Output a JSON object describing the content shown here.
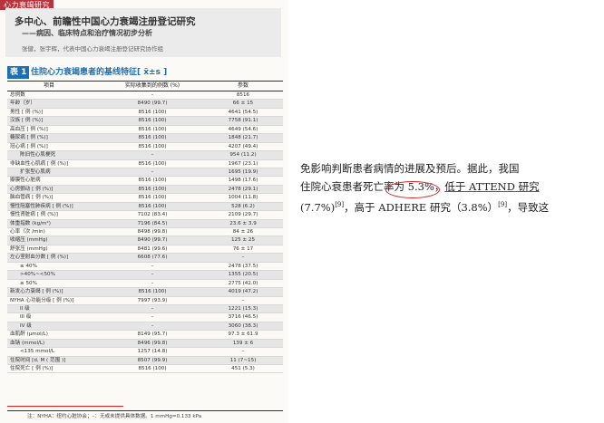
{
  "section_tag": "心力衰竭研究",
  "article": {
    "title": "多中心、前瞻性中国心力衰竭注册登记研究",
    "subtitle": "——病因、临床特点和治疗情况初步分析",
    "authors": "张健，张宇辉，代表中国心力衰竭注册登记研究协作组"
  },
  "table": {
    "number": "表 1",
    "title": "住院心力衰竭患者的基线特征[ x̄±s ]",
    "headers": [
      "项目",
      "实际收集到的例数 (%)",
      "参数"
    ],
    "rows": [
      [
        "总例数",
        "–",
        "8516"
      ],
      [
        "年龄（岁）",
        "8490 (99.7)",
        "66 ± 15"
      ],
      [
        "男性 [ 例 (%)]",
        "8516 (100)",
        "4641 (54.5)"
      ],
      [
        "汉族 [ 例 (%)]",
        "8516 (100)",
        "7758 (91.1)"
      ],
      [
        "高血压 [ 例 (%)]",
        "8516 (100)",
        "4649 (54.6)"
      ],
      [
        "糖尿病 [ 例 (%)]",
        "8516 (100)",
        "1848 (21.7)"
      ],
      [
        "冠心病 [ 例 (%)]",
        "8516 (100)",
        "4207 (49.4)"
      ],
      [
        "陈旧性心肌梗死",
        "–",
        "954 (11.2)"
      ],
      [
        "非缺血性心肌病 [ 例 (%)]",
        "8516 (100)",
        "1967 (23.1)"
      ],
      [
        "扩张型心肌病",
        "–",
        "1695 (19.9)"
      ],
      [
        "瓣膜性心脏病",
        "8516 (100)",
        "1498 (17.6)"
      ],
      [
        "心房颤动 [ 例 (%)]",
        "8516 (100)",
        "2478 (29.1)"
      ],
      [
        "脑血管病 [ 例 (%)]",
        "8516 (100)",
        "1004 (11.8)"
      ],
      [
        "慢性阻塞性肺疾病 [ 例 (%)]",
        "8516 (100)",
        "528 (6.2)"
      ],
      [
        "慢性肾脏病 [ 例 (%)]",
        "7102 (83.4)",
        "2109 (29.7)"
      ],
      [
        "体重指数 (kg/m²)",
        "7196 (84.5)",
        "23.6 ± 3.9"
      ],
      [
        "心率（次 /min)",
        "8498 (99.8)",
        "84 ± 26"
      ],
      [
        "收缩压 (mmHg)",
        "8490 (99.7)",
        "125 ± 25"
      ],
      [
        "舒张压 (mmHg)",
        "8481 (99.6)",
        "76 ± 17"
      ],
      [
        "左心室射血分数 [ 例 (%)]",
        "6608 (77.6)",
        "–"
      ],
      [
        "≤ 40%",
        "–",
        "2478 (37.5)"
      ],
      [
        ">40%~<50%",
        "–",
        "1355 (20.5)"
      ],
      [
        "≥ 50%",
        "–",
        "2775 (42.0)"
      ],
      [
        "新发心力衰竭 [ 例 (%)]",
        "8516 (100)",
        "4019 (47.2)"
      ],
      [
        "NYHA 心功能分级 [ 例 (%)]",
        "7997 (93.9)",
        "–"
      ],
      [
        "II 级",
        "–",
        "1221 (15.3)"
      ],
      [
        "III 级",
        "–",
        "3716 (46.5)"
      ],
      [
        "IV 级",
        "–",
        "3060 (38.3)"
      ],
      [
        "血肌酐 (μmol/L)",
        "8149 (95.7)",
        "97.3 ± 61.9"
      ],
      [
        "血钠 (mmol/L)",
        "8496 (99.8)",
        "139 ± 6"
      ],
      [
        "<135 mmol/L",
        "1257 (14.8)",
        "–"
      ],
      [
        "住院时间 [d, M ( 范围 )]",
        "8507 (99.9)",
        "11 (7~15)"
      ],
      [
        "住院死亡 [ 例 (%)]",
        "8516 (100)",
        "451 (5.3)"
      ]
    ],
    "footnote": "注：NYHA：纽约心脏协会；–：无或未提供具体数据。1 mmHg=0.133 kPa"
  },
  "body_text": {
    "line1": "免影响判断患者病情的进展及预后。据此，我国",
    "line2_a": "住院心衰患者死亡率",
    "line2_b": "为 5.3%，",
    "line2_c": "低于 ATTEND 研究",
    "line3": "(7.7%)",
    "line3_ref": "[9]",
    "line3_b": "，高于 ADHERE 研究（3.8%）",
    "line3_ref2": "[9]",
    "line3_c": "，导致这"
  },
  "colors": {
    "tag_red": "#b8333b",
    "table_blue": "#1d6fb3",
    "annotation_red": "#dd2222"
  }
}
